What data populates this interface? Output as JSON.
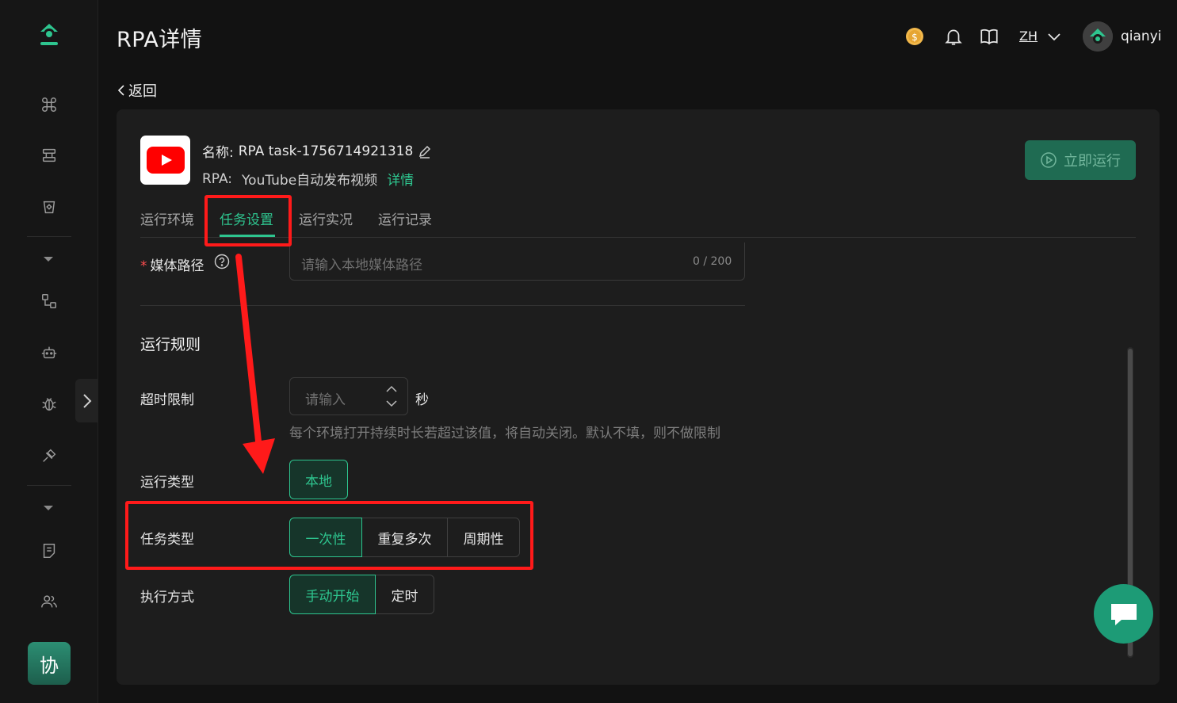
{
  "header": {
    "title": "RPA详情",
    "lang": "ZH",
    "username": "qianyi"
  },
  "nav": {
    "back_label": "返回",
    "collab_label": "协"
  },
  "task": {
    "name_label": "名称:",
    "name_value": "RPA task-1756714921318",
    "rpa_label": "RPA:",
    "rpa_value": "YouTube自动发布视频",
    "detail_link": "详情",
    "run_now_label": "立即运行"
  },
  "tabs": [
    {
      "label": "运行环境",
      "active": false
    },
    {
      "label": "任务设置",
      "active": true
    },
    {
      "label": "运行实况",
      "active": false
    },
    {
      "label": "运行记录",
      "active": false
    }
  ],
  "form": {
    "media_path": {
      "label": "媒体路径",
      "placeholder": "请输入本地媒体路径",
      "count": "0 / 200"
    },
    "section_title": "运行规则",
    "timeout": {
      "label": "超时限制",
      "placeholder": "请输入",
      "unit": "秒",
      "hint": "每个环境打开持续时长若超过该值，将自动关闭。默认不填，则不做限制"
    },
    "run_type": {
      "label": "运行类型",
      "options": [
        "本地"
      ],
      "selected": "本地"
    },
    "task_type": {
      "label": "任务类型",
      "options": [
        "一次性",
        "重复多次",
        "周期性"
      ],
      "selected": "一次性"
    },
    "exec_mode": {
      "label": "执行方式",
      "options": [
        "手动开始",
        "定时"
      ],
      "selected": "手动开始"
    }
  },
  "colors": {
    "accent": "#2ec58f",
    "annotation": "#ff1a1a",
    "background": "#121212",
    "card": "#1d1d1d"
  }
}
